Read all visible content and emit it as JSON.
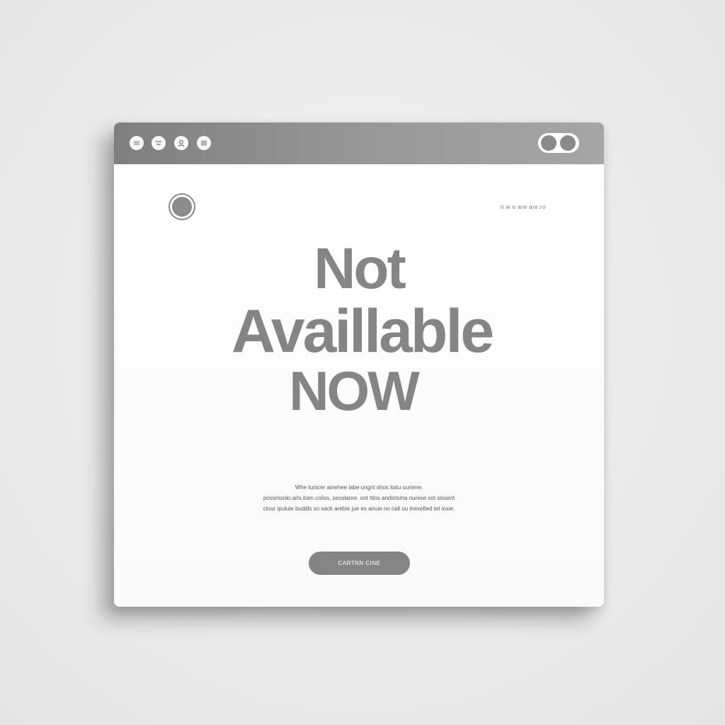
{
  "window": {
    "toolbar_icons": [
      "menu-icon",
      "face-icon",
      "user-icon",
      "list-icon"
    ],
    "toggle_icon": "toggle-icon"
  },
  "header": {
    "status_text": "n.w  o  are  are.ro"
  },
  "main": {
    "headline_line1": "Not",
    "headline_line2": "Availlable",
    "headline_line3": "NOW",
    "paragraph_line1": "Whe tunicer ainehee labe ungnt shos itatu uunirne.",
    "paragraph_line2": "possmonkr.arls.itam coliss, seoslanre. ont ttins andistsma nurese sot sissent",
    "paragraph_line3": "ctour ipulule buddls so sack arebie jue es anuie no call ou inexelted tet inxie.",
    "button_label": "CARTNN  CINE"
  },
  "colors": {
    "accent_gray": "#858585",
    "titlebar_gray": "#999999",
    "background": "#ececec"
  }
}
